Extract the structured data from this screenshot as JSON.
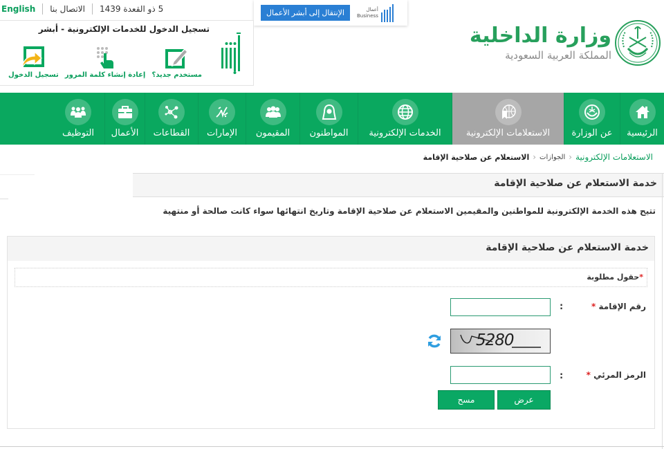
{
  "topbar": {
    "english_label": "English",
    "contact_label": "الاتصال بنا",
    "date": "5 ذو القعدة 1439"
  },
  "business_strip": {
    "button_label": "الإنتقال إلى أبشر الأعمال",
    "logo_text_ar": "أعمال",
    "logo_text_en": "Business"
  },
  "login": {
    "title": "تسجيل الدخول للخدمات الإلكترونية - أبشر",
    "logo_name": "absher-logo",
    "actions": [
      {
        "label": "مستخدم جديد؟",
        "icon": "new-user-icon"
      },
      {
        "label": "إعادة إنشاء كلمة المرور",
        "icon": "reset-password-icon"
      },
      {
        "label": "تسجيل الدخول",
        "icon": "login-icon"
      }
    ]
  },
  "ministry": {
    "name": "وزارة الداخلية",
    "subtitle": "المملكة العربية السعودية"
  },
  "nav": {
    "items": [
      {
        "label": "الرئيسية",
        "icon": "home-icon",
        "active": false
      },
      {
        "label": "عن الوزارة",
        "icon": "ministry-emblem-icon",
        "active": false
      },
      {
        "label": "الاستعلامات الإلكترونية",
        "icon": "e-inquiries-icon",
        "active": true
      },
      {
        "label": "الخدمات الإلكترونية",
        "icon": "globe-icon",
        "active": false
      },
      {
        "label": "المواطنون",
        "icon": "citizen-icon",
        "active": false
      },
      {
        "label": "المقيمون",
        "icon": "residents-icon",
        "active": false
      },
      {
        "label": "الإمارات",
        "icon": "emirates-icon",
        "active": false
      },
      {
        "label": "القطاعات",
        "icon": "sectors-icon",
        "active": false
      },
      {
        "label": "الأعمال",
        "icon": "briefcase-icon",
        "active": false
      },
      {
        "label": "التوظيف",
        "icon": "employment-icon",
        "active": false
      }
    ]
  },
  "breadcrumb": {
    "root": "الاستعلامات الإلكترونية",
    "middle": "الجوازات",
    "current": "الاستعلام عن صلاحية الإقامة",
    "separator": ">"
  },
  "page": {
    "title": "خدمة الاستعلام عن صلاحية الإقامة",
    "intro": "تتيح هذه الخدمة الإلكترونية للمواطنين والمقيمين الاستعلام عن صلاحية الإقامة وتاريخ انتهائها سواء كانت صالحة أو منتهية"
  },
  "form": {
    "title": "خدمة الاستعلام عن صلاحية الإقامة",
    "required_note": "حقول مطلوبة",
    "required_star": "*",
    "colon": ":",
    "iqama_label": "رقم الإقامة",
    "iqama_value": "",
    "captcha_text": "5280",
    "captcha_label": "الرمز المرئي",
    "captcha_value": "",
    "submit_label": "عرض",
    "clear_label": "مسح"
  },
  "colors": {
    "brand_green": "#0aa85f",
    "active_nav": "#a6a6a6",
    "business_blue": "#2a7fd4",
    "required_red": "#d22222"
  }
}
